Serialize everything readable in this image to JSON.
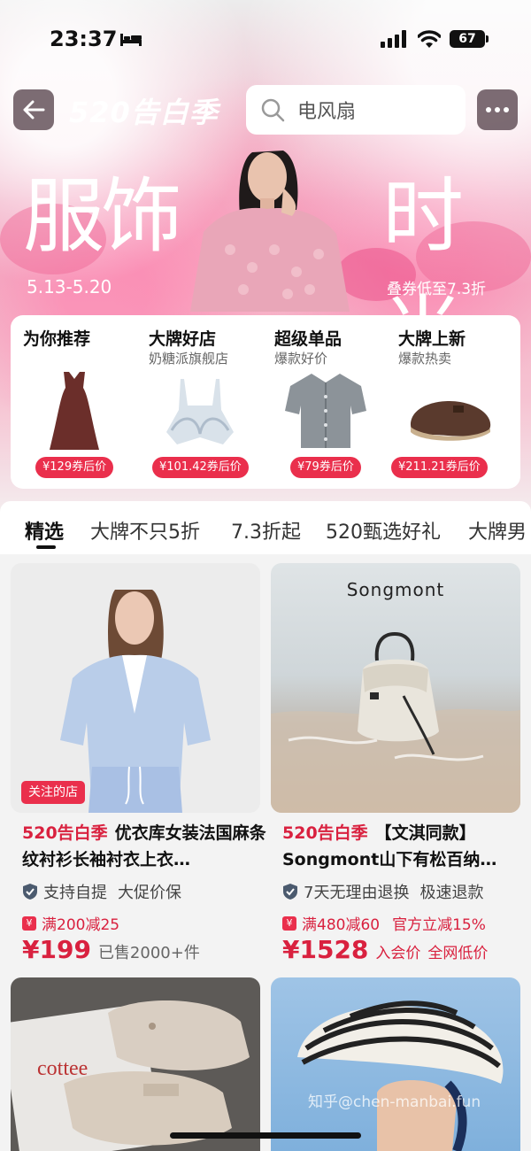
{
  "status": {
    "time": "23:37",
    "battery": "67"
  },
  "header": {
    "brand_title": "520告白季",
    "search_placeholder": "电风扇"
  },
  "banner": {
    "left_text": "服饰",
    "right_text": "时尚",
    "date_range": "5.13-5.20",
    "coupon_note": "叠券低至7.3折"
  },
  "categories": [
    {
      "title": "为你推荐",
      "subtitle": "",
      "price": "¥129券后价",
      "icon": "dress-icon"
    },
    {
      "title": "大牌好店",
      "subtitle": "奶糖派旗舰店",
      "price": "¥101.42券后价",
      "icon": "bra-icon"
    },
    {
      "title": "超级单品",
      "subtitle": "爆款好价",
      "price": "¥79券后价",
      "icon": "cardigan-icon"
    },
    {
      "title": "大牌上新",
      "subtitle": "爆款热卖",
      "price": "¥211.21券后价",
      "icon": "clog-icon"
    }
  ],
  "tabs": [
    "精选",
    "大牌不只5折",
    "7.3折起",
    "520甄选好礼",
    "大牌男"
  ],
  "products": [
    {
      "badge": "关注的店",
      "tag": "520告白季",
      "title": "优衣库女装法国麻条纹衬衫长袖衬衣上衣…",
      "services": [
        "支持自提",
        "大促价保"
      ],
      "promo": "满200减25",
      "price": "¥199",
      "price_note": "已售2000+件"
    },
    {
      "brand_logo": "Songmont",
      "tag": "520告白季",
      "title": "【文淇同款】Songmont山下有松百纳…",
      "services": [
        "7天无理由退换",
        "极速退款"
      ],
      "promo": "满480减60",
      "promo_extra": "官方立减15%",
      "price": "¥1528",
      "price_note": "入会价",
      "price_note2": "全网低价"
    },
    {
      "brand_logo": "cottee"
    },
    {}
  ],
  "watermark": "知乎@chen-manbai.fun"
}
